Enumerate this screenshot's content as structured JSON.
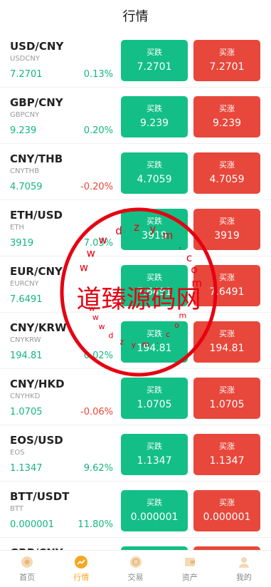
{
  "header": {
    "title": "行情"
  },
  "buttons": {
    "sell_label": "买跌",
    "buy_label": "买涨"
  },
  "rows": [
    {
      "pair": "USD/CNY",
      "code": "USDCNY",
      "price": "7.2701",
      "change": "0.13%",
      "dir": "up",
      "sell": "7.2701",
      "buy": "7.2701"
    },
    {
      "pair": "GBP/CNY",
      "code": "GBPCNY",
      "price": "9.239",
      "change": "0.20%",
      "dir": "up",
      "sell": "9.239",
      "buy": "9.239"
    },
    {
      "pair": "CNY/THB",
      "code": "CNYTHB",
      "price": "4.7059",
      "change": "-0.20%",
      "dir": "down",
      "sell": "4.7059",
      "buy": "4.7059"
    },
    {
      "pair": "ETH/USD",
      "code": "ETH",
      "price": "3919",
      "change": "7.03%",
      "dir": "up",
      "sell": "3919",
      "buy": "3919"
    },
    {
      "pair": "EUR/CNY",
      "code": "EURCNY",
      "price": "7.6491",
      "change": "",
      "dir": "up",
      "sell": "7.6491",
      "buy": "7.6491"
    },
    {
      "pair": "CNY/KRW",
      "code": "CNYKRW",
      "price": "194.81",
      "change": "0.02%",
      "dir": "up",
      "sell": "194.81",
      "buy": "194.81"
    },
    {
      "pair": "CNY/HKD",
      "code": "CNYHKD",
      "price": "1.0705",
      "change": "-0.06%",
      "dir": "down",
      "sell": "1.0705",
      "buy": "1.0705"
    },
    {
      "pair": "EOS/USD",
      "code": "EOS",
      "price": "1.1347",
      "change": "9.62%",
      "dir": "up",
      "sell": "1.1347",
      "buy": "1.1347"
    },
    {
      "pair": "BTT/USDT",
      "code": "BTT",
      "price": "0.000001",
      "change": "11.80%",
      "dir": "up",
      "sell": "0.000001",
      "buy": "0.000001"
    },
    {
      "pair": "GBP/CNY",
      "code": "",
      "price": "",
      "change": "",
      "dir": "up",
      "sell": "",
      "buy": ""
    }
  ],
  "tabbar": {
    "items": [
      {
        "label": "首页",
        "icon": "home-icon"
      },
      {
        "label": "行情",
        "icon": "market-chart-icon",
        "active": true
      },
      {
        "label": "交易",
        "icon": "trade-icon"
      },
      {
        "label": "资产",
        "icon": "wallet-icon"
      },
      {
        "label": "我的",
        "icon": "profile-icon"
      }
    ]
  },
  "watermark": {
    "center_text": "道臻源码网",
    "ring_text": "www.dzym.com",
    "color": "#e60012"
  },
  "colors": {
    "up": "#13b680",
    "down": "#e8473b",
    "sell_button": "#13bf86",
    "buy_button": "#e8473b",
    "active_tab": "#f5a623",
    "inactive_tab": "#888888"
  }
}
